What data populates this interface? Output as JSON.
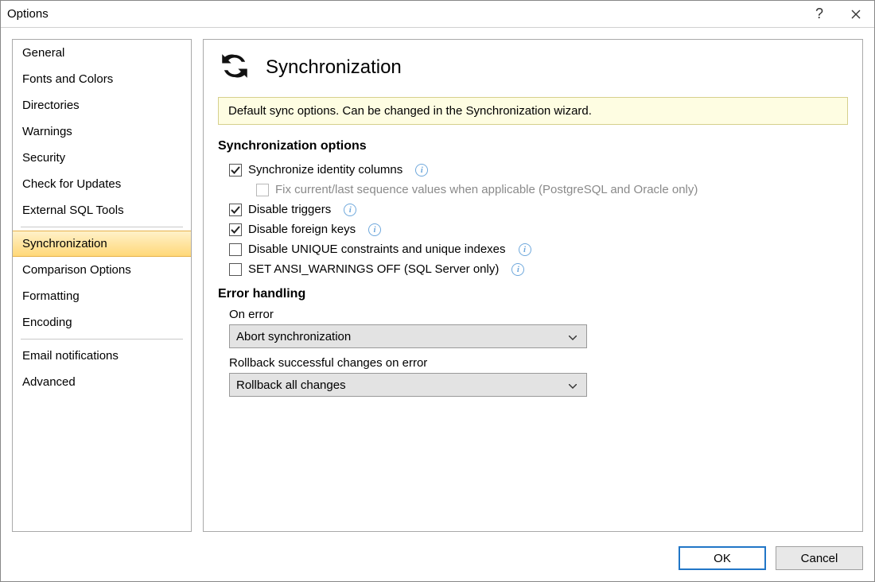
{
  "window": {
    "title": "Options"
  },
  "sidebar": {
    "groups": [
      [
        "General",
        "Fonts and Colors",
        "Directories",
        "Warnings",
        "Security",
        "Check for Updates",
        "External SQL Tools"
      ],
      [
        "Synchronization",
        "Comparison Options",
        "Formatting",
        "Encoding"
      ],
      [
        "Email notifications",
        "Advanced"
      ]
    ],
    "selected": "Synchronization"
  },
  "page": {
    "title": "Synchronization",
    "banner": "Default sync options. Can be changed in the Synchronization wizard.",
    "sync_section": "Synchronization options",
    "error_section": "Error handling",
    "checks": {
      "identity": {
        "label": "Synchronize identity columns",
        "checked": true,
        "info": true
      },
      "fix_seq": {
        "label": "Fix current/last sequence values when applicable (PostgreSQL and Oracle only)",
        "checked": false,
        "disabled": true
      },
      "triggers": {
        "label": "Disable triggers",
        "checked": true,
        "info": true
      },
      "fk": {
        "label": "Disable foreign keys",
        "checked": true,
        "info": true
      },
      "unique": {
        "label": "Disable UNIQUE constraints and unique indexes",
        "checked": false,
        "info": true
      },
      "ansi": {
        "label": "SET ANSI_WARNINGS OFF (SQL Server only)",
        "checked": false,
        "info": true
      }
    },
    "on_error": {
      "label": "On error",
      "value": "Abort synchronization"
    },
    "rollback": {
      "label": "Rollback successful changes on error",
      "value": "Rollback all changes"
    }
  },
  "buttons": {
    "ok": "OK",
    "cancel": "Cancel"
  }
}
